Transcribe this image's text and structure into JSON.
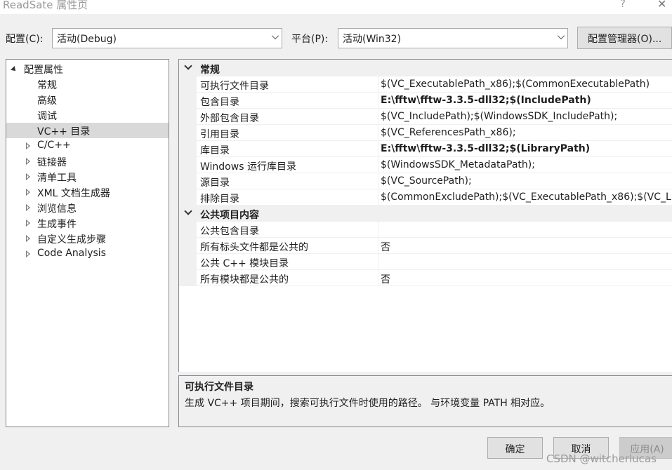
{
  "window": {
    "title": "ReadSate 属性页",
    "help_glyph": "?",
    "close_glyph": "✕"
  },
  "toolbar": {
    "config_label": "配置(C):",
    "config_value": "活动(Debug)",
    "platform_label": "平台(P):",
    "platform_value": "活动(Win32)",
    "config_manager_label": "配置管理器(O)..."
  },
  "tree": {
    "root": "配置属性",
    "items": [
      {
        "label": "常规",
        "expandable": false,
        "selected": false
      },
      {
        "label": "高级",
        "expandable": false,
        "selected": false
      },
      {
        "label": "调试",
        "expandable": false,
        "selected": false
      },
      {
        "label": "VC++ 目录",
        "expandable": false,
        "selected": true
      },
      {
        "label": "C/C++",
        "expandable": true,
        "selected": false
      },
      {
        "label": "链接器",
        "expandable": true,
        "selected": false
      },
      {
        "label": "清单工具",
        "expandable": true,
        "selected": false
      },
      {
        "label": "XML 文档生成器",
        "expandable": true,
        "selected": false
      },
      {
        "label": "浏览信息",
        "expandable": true,
        "selected": false
      },
      {
        "label": "生成事件",
        "expandable": true,
        "selected": false
      },
      {
        "label": "自定义生成步骤",
        "expandable": true,
        "selected": false
      },
      {
        "label": "Code Analysis",
        "expandable": true,
        "selected": false
      }
    ]
  },
  "grid": {
    "categories": [
      {
        "title": "常规",
        "rows": [
          {
            "name": "可执行文件目录",
            "value": "$(VC_ExecutablePath_x86);$(CommonExecutablePath)",
            "bold": false
          },
          {
            "name": "包含目录",
            "value": "E:\\fftw\\fftw-3.3.5-dll32;$(IncludePath)",
            "bold": true
          },
          {
            "name": "外部包含目录",
            "value": "$(VC_IncludePath);$(WindowsSDK_IncludePath);",
            "bold": false
          },
          {
            "name": "引用目录",
            "value": "$(VC_ReferencesPath_x86);",
            "bold": false
          },
          {
            "name": "库目录",
            "value": "E:\\fftw\\fftw-3.3.5-dll32;$(LibraryPath)",
            "bold": true
          },
          {
            "name": "Windows 运行库目录",
            "value": "$(WindowsSDK_MetadataPath);",
            "bold": false
          },
          {
            "name": "源目录",
            "value": "$(VC_SourcePath);",
            "bold": false
          },
          {
            "name": "排除目录",
            "value": "$(CommonExcludePath);$(VC_ExecutablePath_x86);$(VC_L",
            "bold": false
          }
        ]
      },
      {
        "title": "公共项目内容",
        "rows": [
          {
            "name": "公共包含目录",
            "value": "",
            "bold": false
          },
          {
            "name": "所有标头文件都是公共的",
            "value": "否",
            "bold": false
          },
          {
            "name": "公共 C++ 模块目录",
            "value": "",
            "bold": false
          },
          {
            "name": "所有模块都是公共的",
            "value": "否",
            "bold": false
          }
        ]
      }
    ]
  },
  "description": {
    "title": "可执行文件目录",
    "text": "生成 VC++ 项目期间，搜索可执行文件时使用的路径。 与环境变量 PATH 相对应。"
  },
  "buttons": {
    "ok": "确定",
    "cancel": "取消",
    "apply": "应用(A)"
  },
  "watermark": "CSDN @witcherlucas"
}
